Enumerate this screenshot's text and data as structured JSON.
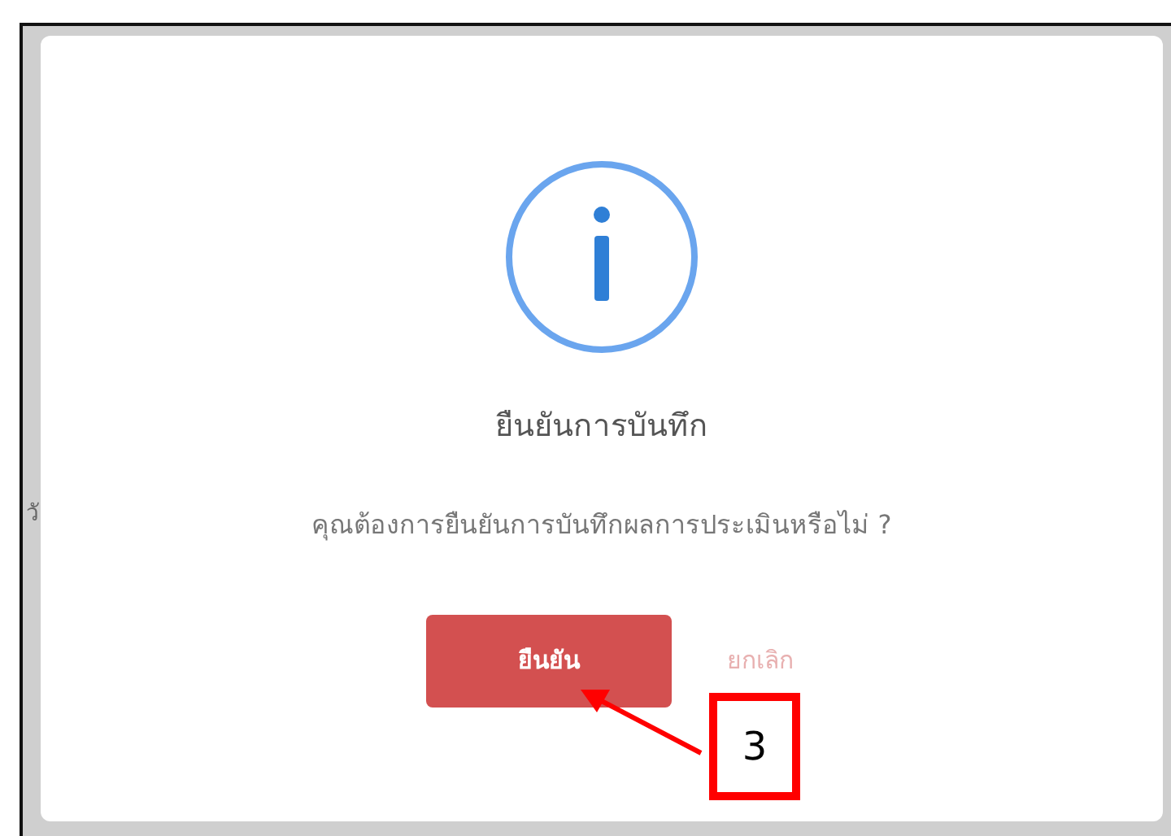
{
  "background": {
    "side_text": "วั"
  },
  "dialog": {
    "title": "ยืนยันการบันทึก",
    "message": "คุณต้องการยืนยันการบันทึกผลการประเมินหรือไม่ ?",
    "buttons": [
      {
        "label": "ยืนยัน",
        "kind": "confirm"
      },
      {
        "label": "ยกเลิก",
        "kind": "cancel"
      }
    ]
  },
  "annotation": {
    "label": "3"
  }
}
